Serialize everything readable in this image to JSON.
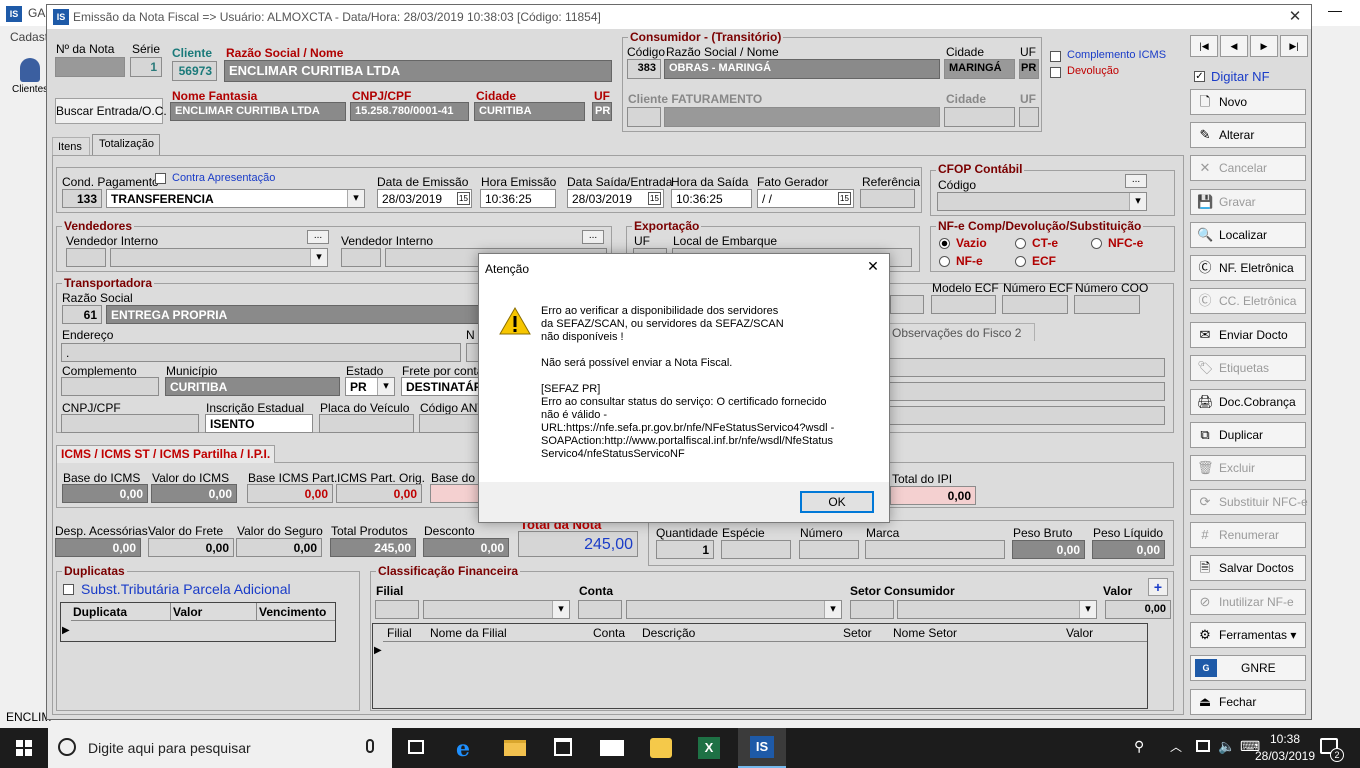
{
  "bg": {
    "app_title_fragment": "GAD",
    "menu_cadastro": "Cadastr",
    "clientes": "Clientes",
    "status_fragment": "ENCLIM"
  },
  "window": {
    "title": "Emissão da Nota Fiscal  => Usuário: ALMOXCTA - Data/Hora: 28/03/2019 10:38:03  [Código: 11854]",
    "close": "✕"
  },
  "header": {
    "nota_label": "Nº da Nota",
    "nota_value": "",
    "serie_label": "Série",
    "serie_value": "1",
    "cliente_label": "Cliente",
    "cliente_code": "56973",
    "razao_label": "Razão Social / Nome",
    "razao_value": "ENCLIMAR CURITIBA LTDA",
    "buscar": "Buscar Entrada/O.C.",
    "fantasia_label": "Nome Fantasia",
    "fantasia_value": "ENCLIMAR CURITIBA LTDA",
    "cnpj_label": "CNPJ/CPF",
    "cnpj_value": "15.258.780/0001-41",
    "cidade_label": "Cidade",
    "cidade_value": "CURITIBA",
    "uf_label": "UF",
    "uf_value": "PR"
  },
  "consumidor": {
    "title": "Consumidor - (Transitório)",
    "codigo_label": "Código",
    "razao_label": "Razão Social / Nome",
    "cidade_label": "Cidade",
    "uf_label": "UF",
    "codigo": "383",
    "razao": "OBRAS  - MARINGÁ",
    "cidade": "MARINGÁ",
    "uf": "PR",
    "fat_label": "Cliente FATURAMENTO",
    "fat_cidade": "Cidade",
    "fat_uf": "UF"
  },
  "options": {
    "complemento": "Complemento ICMS",
    "devolucao": "Devolução",
    "digitar": "Digitar NF"
  },
  "tabs": [
    "Itens",
    "Totalização"
  ],
  "cond": {
    "label": "Cond. Pagamento",
    "code": "133",
    "value": "TRANSFERENCIA",
    "contra": "Contra Apresentação"
  },
  "datas": {
    "emissao_label": "Data de Emissão",
    "emissao": "28/03/2019",
    "hora_em_label": "Hora Emissão",
    "hora_em": "10:36:25",
    "saida_label": "Data Saída/Entrada",
    "saida": "28/03/2019",
    "hora_sa_label": "Hora da Saída",
    "hora_sa": "10:36:25",
    "fato_label": "Fato Gerador",
    "fato": "  /  /",
    "ref_label": "Referência"
  },
  "cfop": {
    "title": "CFOP Contábil",
    "codigo": "Código",
    "ellipsis": "..."
  },
  "vendedores": {
    "title": "Vendedores",
    "interno1": "Vendedor Interno",
    "interno2": "Vendedor Interno"
  },
  "exportacao": {
    "title": "Exportação",
    "uf": "UF",
    "local": "Local de Embarque"
  },
  "nfe": {
    "title": "NF-e Comp/Devolução/Substituição",
    "vazio": "Vazio",
    "cte": "CT-e",
    "nfce": "NFC-e",
    "nfe": "NF-e",
    "ecf": "ECF"
  },
  "ecf": {
    "modelo": "Modelo ECF",
    "numero": "Número ECF",
    "coo": "Número COO",
    "obs2": "Observações do Fisco 2"
  },
  "transp": {
    "title": "Transportadora",
    "razao_label": "Razão Social",
    "code": "61",
    "razao": "ENTREGA PROPRIA",
    "endereco_label": "Endereço",
    "endereco": ".",
    "num_label": "N",
    "complemento_label": "Complemento",
    "municipio_label": "Município",
    "municipio": "CURITIBA",
    "estado_label": "Estado",
    "estado": "PR",
    "frete_label": "Frete por conta d",
    "frete": "DESTINATÁR",
    "cnpj_label": "CNPJ/CPF",
    "ie_label": "Inscrição Estadual",
    "ie": "ISENTO",
    "placa_label": "Placa do Veículo",
    "codant_label": "Código ANT"
  },
  "icms": {
    "title": "ICMS / ICMS ST / ICMS Partilha / I.P.I.",
    "base_label": "Base do ICMS",
    "base": "0,00",
    "valor_label": "Valor do ICMS",
    "valor": "0,00",
    "basepart_label": "Base ICMS Part.",
    "basepart": "0,00",
    "partorig_label": "ICMS Part. Orig.",
    "partorig": "0,00",
    "baseipi_label": "Base do IP",
    "totalipi_label": "Total do IPI",
    "totalipi": "0,00"
  },
  "totais": {
    "desp_label": "Desp. Acessórias",
    "desp": "0,00",
    "frete_label": "Valor do Frete",
    "frete": "0,00",
    "seguro_label": "Valor do Seguro",
    "seguro": "0,00",
    "prod_label": "Total Produtos",
    "prod": "245,00",
    "desc_label": "Desconto",
    "desc": "0,00",
    "nota_label": "Total da Nota",
    "nota": "245,00",
    "qtd_label": "Quantidade",
    "qtd": "1",
    "especie_label": "Espécie",
    "numero_label": "Número",
    "marca_label": "Marca",
    "pbruto_label": "Peso Bruto",
    "pbruto": "0,00",
    "pliq_label": "Peso Líquido",
    "pliq": "0,00"
  },
  "duplicatas": {
    "title": "Duplicatas",
    "subst": "Subst.Tributária Parcela Adicional",
    "cols": [
      "Duplicata",
      "Valor",
      "Vencimento"
    ]
  },
  "classif": {
    "title": "Classificação Financeira",
    "filial": "Filial",
    "conta": "Conta",
    "setor": "Setor Consumidor",
    "valor": "Valor",
    "valor_value": "0,00",
    "plus": "+",
    "cols": [
      "Filial",
      "Nome da Filial",
      "Conta",
      "Descrição",
      "Setor",
      "Nome Setor",
      "Valor"
    ]
  },
  "sidebar": {
    "nav": [
      "|◀",
      "◀",
      "▶",
      "▶|"
    ],
    "buttons": [
      {
        "label": "Novo",
        "icon": "new-doc-icon",
        "glyph": "🗋",
        "enabled": true
      },
      {
        "label": "Alterar",
        "icon": "edit-icon",
        "glyph": "✎",
        "enabled": true
      },
      {
        "label": "Cancelar",
        "icon": "cancel-icon",
        "glyph": "✕",
        "enabled": false
      },
      {
        "label": "Gravar",
        "icon": "save-icon",
        "glyph": "💾",
        "enabled": false
      },
      {
        "label": "Localizar",
        "icon": "search-icon",
        "glyph": "🔍",
        "enabled": true
      },
      {
        "label": "NF. Eletrônica",
        "icon": "nfe-icon",
        "glyph": "Ⓒ",
        "enabled": true
      },
      {
        "label": "CC. Eletrônica",
        "icon": "cce-icon",
        "glyph": "Ⓒ",
        "enabled": false
      },
      {
        "label": "Enviar Docto",
        "icon": "send-doc-icon",
        "glyph": "✉",
        "enabled": true
      },
      {
        "label": "Etiquetas",
        "icon": "labels-icon",
        "glyph": "🏷",
        "enabled": false
      },
      {
        "label": "Doc.Cobrança",
        "icon": "billing-doc-icon",
        "glyph": "🖨",
        "enabled": true
      },
      {
        "label": "Duplicar",
        "icon": "duplicate-icon",
        "glyph": "⧉",
        "enabled": true
      },
      {
        "label": "Excluir",
        "icon": "delete-icon",
        "glyph": "🗑",
        "enabled": false
      },
      {
        "label": "Substituir NFC-e",
        "icon": "replace-icon",
        "glyph": "⟳",
        "enabled": false
      },
      {
        "label": "Renumerar",
        "icon": "renumber-icon",
        "glyph": "#",
        "enabled": false
      },
      {
        "label": "Salvar Doctos",
        "icon": "save-docs-icon",
        "glyph": "🗎",
        "enabled": true
      },
      {
        "label": "Inutilizar NF-e",
        "icon": "disable-icon",
        "glyph": "⊘",
        "enabled": false
      },
      {
        "label": "Ferramentas ▾",
        "icon": "tools-icon",
        "glyph": "⚙",
        "enabled": true
      },
      {
        "label": "GNRE",
        "icon": "gnre-icon",
        "glyph": "G",
        "enabled": true
      },
      {
        "label": "Fechar",
        "icon": "exit-icon",
        "glyph": "⏏",
        "enabled": true
      }
    ]
  },
  "dialog": {
    "title": "Atenção",
    "close": "✕",
    "line1": "Erro ao verificar a disponibilidade dos servidores",
    "line2": "da SEFAZ/SCAN, ou servidores da SEFAZ/SCAN",
    "line3": "não disponíveis !",
    "line4": "Não será possível enviar a Nota Fiscal.",
    "line5": "[SEFAZ PR]",
    "line6": "Erro ao consultar status do serviço: O certificado fornecido",
    "line7": "não é válido -",
    "line8": "URL:https://nfe.sefa.pr.gov.br/nfe/NFeStatusServico4?wsdl -",
    "line9": "SOAPAction:http://www.portalfiscal.inf.br/nfe/wsdl/NfeStatus",
    "line10": "Servico4/nfeStatusServicoNF",
    "ok": "OK"
  },
  "taskbar": {
    "search_placeholder": "Digite aqui para pesquisar",
    "time": "10:38",
    "date": "28/03/2019",
    "notif": "2",
    "app_is": "IS"
  },
  "colors": {
    "accent_red": "#7a0000",
    "dark_field": "#8a8a8a",
    "taskbar": "#1c1c1c"
  }
}
